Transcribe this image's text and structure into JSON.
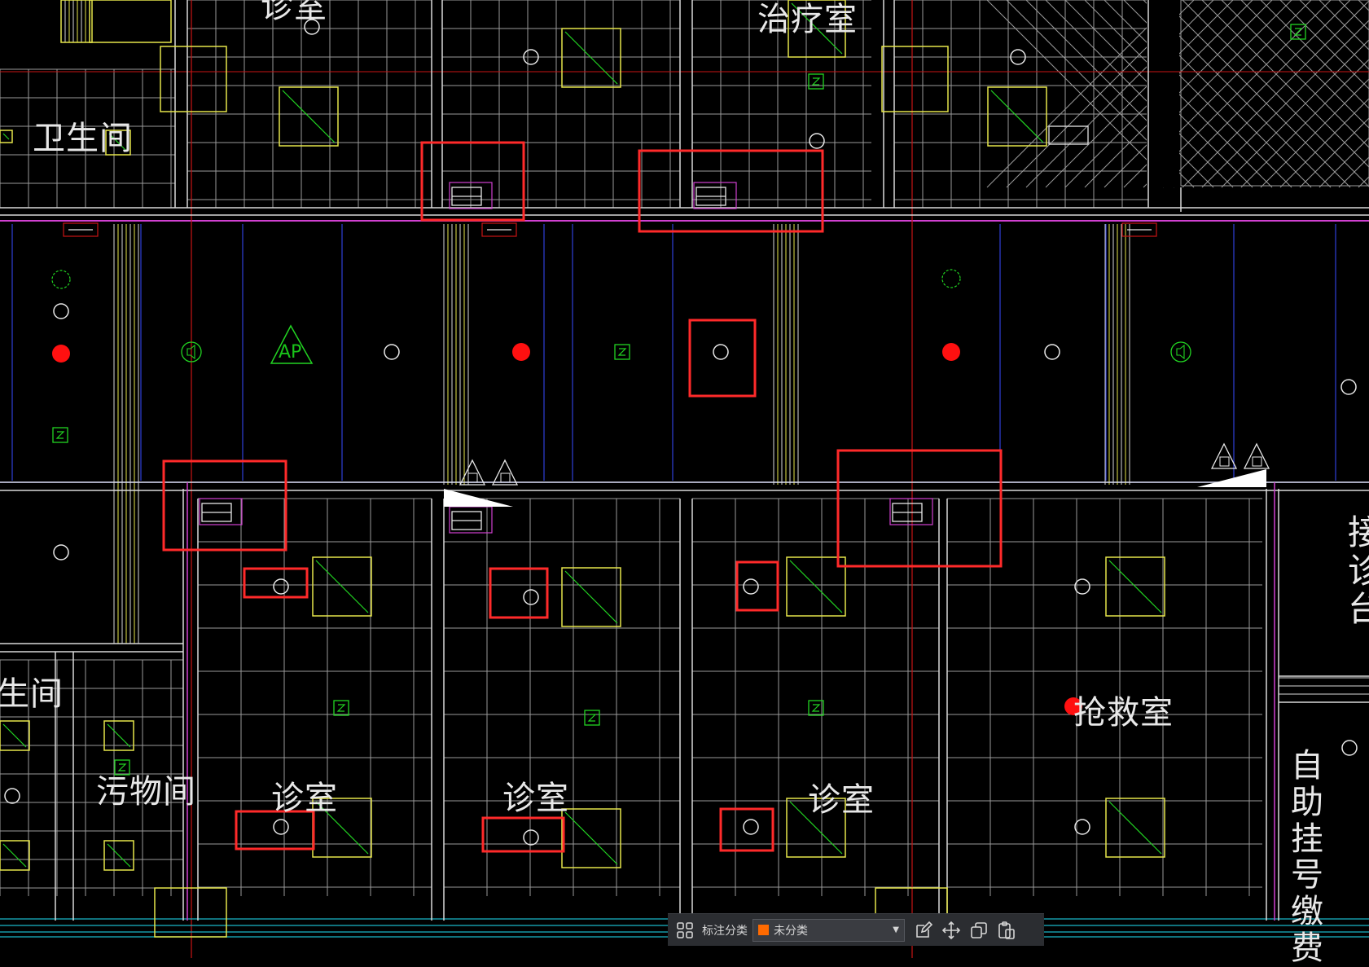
{
  "drawing": {
    "rooms": {
      "top_left_room": "诊室",
      "treatment_room": "治疗室",
      "bathroom_top": "卫生间",
      "bathroom_left": "生间",
      "dirty_room": "污物间",
      "clinic_1": "诊室",
      "clinic_2": "诊室",
      "clinic_3": "诊室",
      "rescue_room": "抢救室",
      "reception_partial": "接诊台",
      "self_service": "自助挂号缴费"
    },
    "ap_label": "AP",
    "colors": {
      "highlight_box": "#ff2a2a",
      "grid_line": "#9a9a9a",
      "wall": "#d9d9d9",
      "furniture_yellow": "#e6e64a",
      "device_green": "#22d422",
      "blue_line": "#2f3fd8",
      "magenta_line": "#d040d0",
      "red_axis": "#c81414",
      "fire_dot": "#ff1010"
    }
  },
  "toolbar": {
    "annotation_category_label": "标注分类",
    "category_select_value": "未分类",
    "swatch_color": "#ff6a00",
    "icons": [
      "grid-view-icon",
      "edit-icon",
      "move-icon",
      "copy-icon",
      "paste-icon"
    ]
  }
}
